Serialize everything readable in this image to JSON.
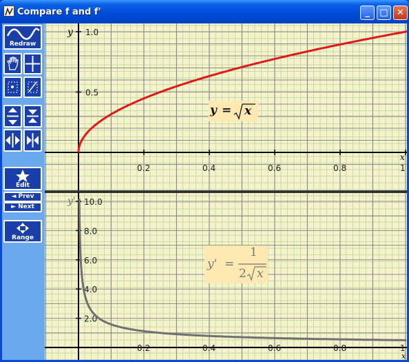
{
  "window": {
    "title": "Compare f and f'",
    "minimize_label": "_",
    "maximize_label": "□",
    "close_label": "✕"
  },
  "toolbar": {
    "redraw_label": "Redraw",
    "edit_label": "Edit",
    "prev_label": "◄ Prev",
    "next_label": "► Next",
    "range_label": "Range",
    "icons": [
      "wave-icon",
      "hand-icon",
      "crosshair-icon",
      "point-select-icon",
      "slope-icon",
      "zoom-in-vertical-icon",
      "zoom-out-vertical-icon",
      "zoom-in-horizontal-icon",
      "zoom-out-horizontal-icon",
      "star-icon",
      "range-arrows-icon"
    ]
  },
  "graph_top": {
    "y_axis_label": "y",
    "x_axis_label": "x",
    "y_ticks": [
      "1.0",
      "0.5"
    ],
    "x_ticks": [
      "0.2",
      "0.4",
      "0.6",
      "0.8",
      "1"
    ],
    "equation": {
      "lhs": "y",
      "equals": "=",
      "radicand": "x"
    },
    "curve_color": "#e01818"
  },
  "graph_bottom": {
    "y_axis_label": "y'",
    "x_axis_label": "x",
    "y_ticks": [
      "10.0",
      "8.0",
      "6.0",
      "4.0",
      "2.0"
    ],
    "x_ticks": [
      "0.2",
      "0.4",
      "0.6",
      "0.8",
      "1"
    ],
    "equation": {
      "lhs": "y'",
      "equals": "=",
      "numerator": "1",
      "denominator_coef": "2",
      "radicand": "x"
    },
    "curve_color": "#707070"
  },
  "colors": {
    "grid_minor": "#bfe0a0",
    "grid_major": "#8a8a8a",
    "background": "#f7f1cd",
    "toolbar": "#6aa9f0",
    "button": "#1a3fa8"
  }
}
